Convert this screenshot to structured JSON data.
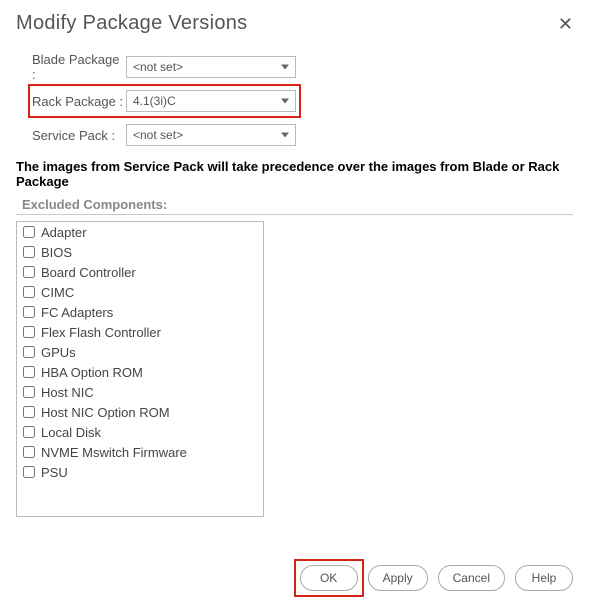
{
  "dialog": {
    "title": "Modify Package Versions",
    "close": "✕"
  },
  "form": {
    "blade_label": "Blade Package :",
    "blade_value": "<not set>",
    "rack_label": "Rack Package   :",
    "rack_value": "4.1(3i)C",
    "service_label": "Service Pack    :",
    "service_value": "<not set>"
  },
  "note": "The images from Service Pack will take precedence over the images from Blade or Rack Package",
  "excluded": {
    "label": "Excluded Components:",
    "items": [
      "Adapter",
      "BIOS",
      "Board Controller",
      "CIMC",
      "FC Adapters",
      "Flex Flash Controller",
      "GPUs",
      "HBA Option ROM",
      "Host NIC",
      "Host NIC Option ROM",
      "Local Disk",
      "NVME Mswitch Firmware",
      "PSU"
    ]
  },
  "buttons": {
    "ok": "OK",
    "apply": "Apply",
    "cancel": "Cancel",
    "help": "Help"
  }
}
